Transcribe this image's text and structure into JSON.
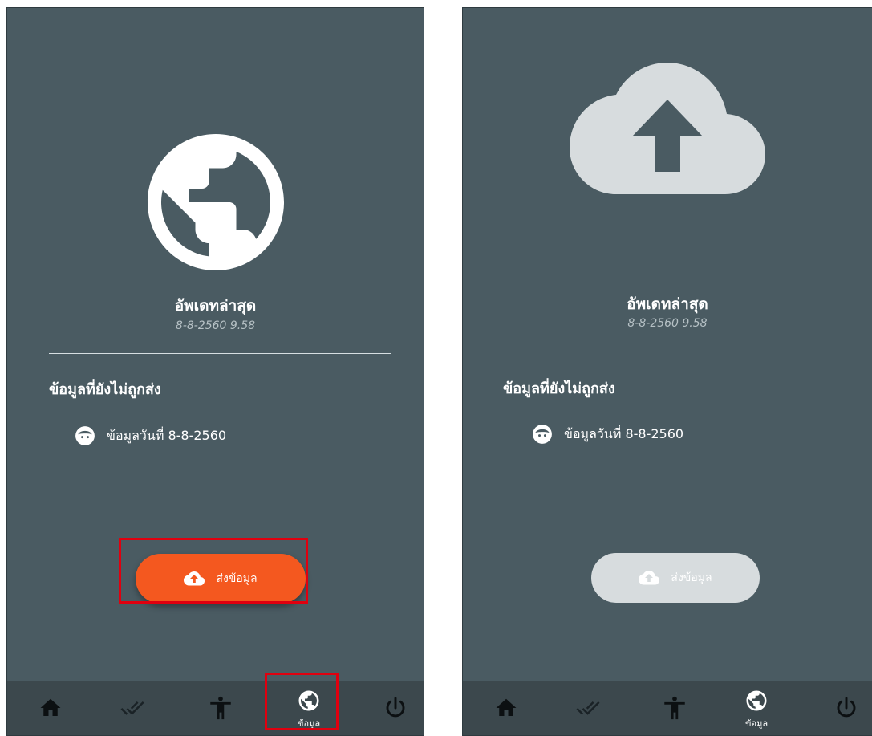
{
  "screens": [
    {
      "update": {
        "title": "อัพเดทล่าสุด",
        "time": "8-8-2560  9.58"
      },
      "pending": {
        "section_title": "ข้อมูลที่ยังไม่ถูกส่ง",
        "items": [
          {
            "label": "ข้อมูลวันที่ 8-8-2560"
          }
        ]
      },
      "send_button": {
        "label": "ส่งข้อมูล",
        "state": "enabled"
      },
      "nav": {
        "active_label": "ข้อมูล"
      }
    },
    {
      "update": {
        "title": "อัพเดทล่าสุด",
        "time": "8-8-2560  9.58"
      },
      "pending": {
        "section_title": "ข้อมูลที่ยังไม่ถูกส่ง",
        "items": [
          {
            "label": "ข้อมูลวันที่ 8-8-2560"
          }
        ]
      },
      "send_button": {
        "label": "ส่งข้อมูล",
        "state": "disabled"
      },
      "nav": {
        "active_label": "ข้อมูล"
      }
    }
  ],
  "icons": {
    "hero_left": "globe-icon",
    "hero_right": "cloud-upload-icon",
    "nav": [
      "home-icon",
      "double-check-icon",
      "accessibility-person-icon",
      "globe-icon",
      "power-icon"
    ]
  },
  "colors": {
    "background": "#4a5b62",
    "nav_background": "#3c484d",
    "send_enabled": "#f4581f",
    "send_disabled": "#d7dcde",
    "highlight": "#e0000f"
  }
}
